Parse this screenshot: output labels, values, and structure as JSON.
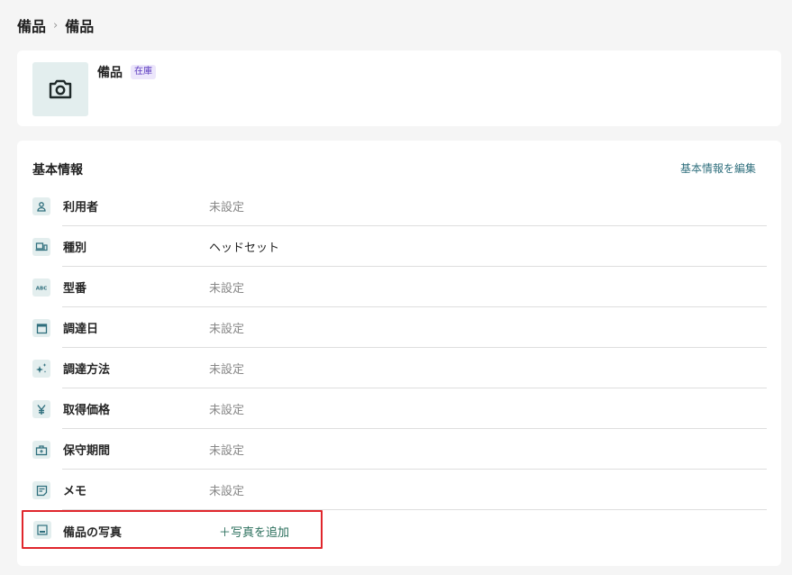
{
  "breadcrumb": {
    "parent": "備品",
    "separator": "›",
    "current": "備品"
  },
  "item": {
    "name": "備品",
    "status_badge": "在庫",
    "thumbnail_icon": "camera-icon"
  },
  "basic_info": {
    "title": "基本情報",
    "edit_label": "基本情報を編集",
    "fields": [
      {
        "icon": "user-icon",
        "label": "利用者",
        "value": "未設定"
      },
      {
        "icon": "device-icon",
        "label": "種別",
        "value": "ヘッドセット"
      },
      {
        "icon": "abc-icon",
        "label": "型番",
        "value": "未設定"
      },
      {
        "icon": "calendar-icon",
        "label": "調達日",
        "value": "未設定"
      },
      {
        "icon": "sparkle-icon",
        "label": "調達方法",
        "value": "未設定"
      },
      {
        "icon": "yen-icon",
        "label": "取得価格",
        "value": "未設定"
      },
      {
        "icon": "briefcase-icon",
        "label": "保守期間",
        "value": "未設定"
      },
      {
        "icon": "memo-icon",
        "label": "メモ",
        "value": "未設定"
      }
    ],
    "photo": {
      "icon": "image-icon",
      "label": "備品の写真",
      "add_label": "＋写真を追加"
    }
  },
  "colors": {
    "accent_teal": "#2f6f7d",
    "add_link_green": "#2b6f5c",
    "badge_purple": "#5b3bbf",
    "highlight_red": "#e0262c"
  }
}
